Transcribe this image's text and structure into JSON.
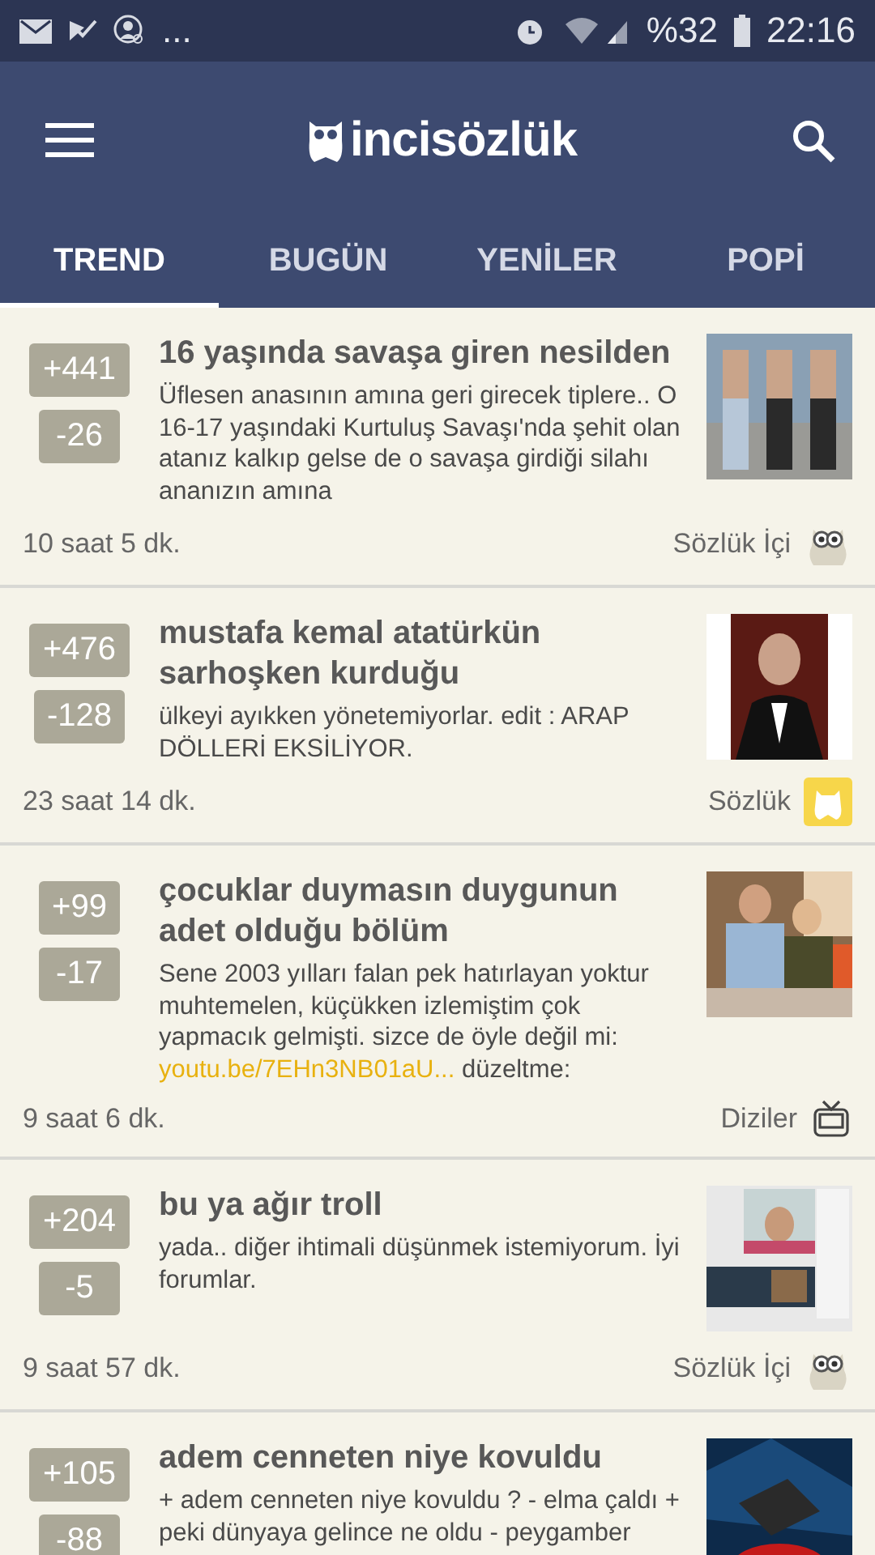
{
  "status_bar": {
    "more": "...",
    "battery": "%32",
    "time": "22:16"
  },
  "header": {
    "logo": "incisözlük"
  },
  "tabs": [
    {
      "label": "TREND",
      "selected": true
    },
    {
      "label": "BUGÜN",
      "selected": false
    },
    {
      "label": "YENİLER",
      "selected": false
    },
    {
      "label": "POPİ",
      "selected": false
    }
  ],
  "entries": [
    {
      "up": "+441",
      "down": "-26",
      "title": "16 yaşında savaşa giren nesilden",
      "body": "Üflesen anasının amına geri girecek tiplere.. O 16-17 yaşındaki Kurtuluş Savaşı'nda şehit olan atanız kalkıp gelse de o savaşa girdiği silahı ananızın amına",
      "time": "10 saat 5 dk.",
      "category": {
        "label": "Sözlük İçi",
        "kind": "owl"
      }
    },
    {
      "up": "+476",
      "down": "-128",
      "title": "mustafa kemal atatürkün sarhoşken kurduğu",
      "body": "ülkeyi ayıkken yönetemiyorlar. edit : ARAP DÖLLERİ EKSİLİYOR.",
      "time": "23 saat 14 dk.",
      "category": {
        "label": "Sözlük",
        "kind": "inci"
      }
    },
    {
      "up": "+99",
      "down": "-17",
      "title": "çocuklar duymasın duygunun adet olduğu bölüm",
      "body": "Sene 2003 yılları falan pek hatırlayan yoktur muhtemelen, küçükken izlemiştim çok yapmacık gelmişti. sizce de öyle değil mi:",
      "link": "youtu.be/7EHn3NB01aU...",
      "after": "düzeltme:",
      "time": "9 saat 6 dk.",
      "category": {
        "label": "Diziler",
        "kind": "tv"
      }
    },
    {
      "up": "+204",
      "down": "-5",
      "title": "bu ya ağır troll",
      "body": "yada.. diğer ihtimali düşünmek istemiyorum. İyi forumlar.",
      "time": "9 saat 57 dk.",
      "category": {
        "label": "Sözlük İçi",
        "kind": "owl"
      }
    },
    {
      "up": "+105",
      "down": "-88",
      "title": "adem cenneten niye kovuldu",
      "body": "+ adem cenneten niye kovuldu ? - elma çaldı + peki dünyaya gelince ne oldu - peygamber"
    }
  ]
}
